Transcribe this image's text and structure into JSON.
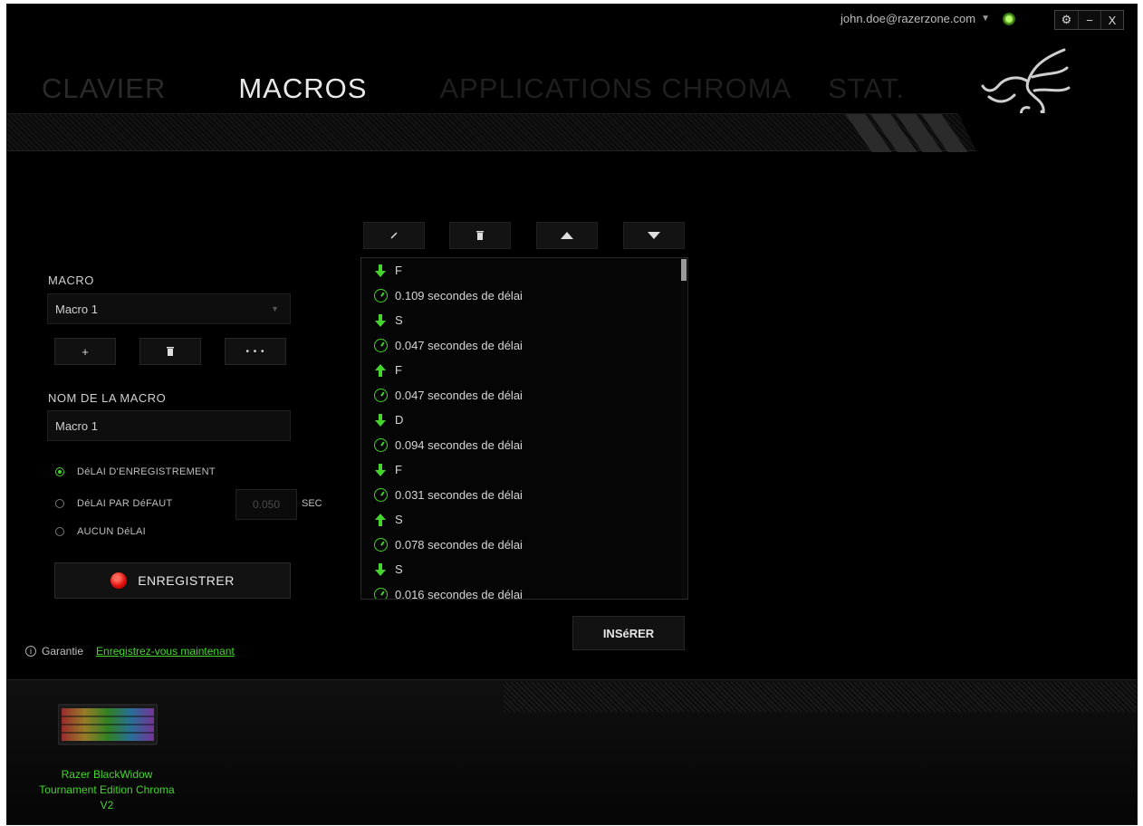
{
  "account": {
    "email": "john.doe@razerzone.com"
  },
  "window_controls": {
    "settings": "⚙",
    "minimize": "−",
    "close": "X"
  },
  "tabs": [
    {
      "label": "CLAVIER",
      "active": false
    },
    {
      "label": "MACROS",
      "active": true
    },
    {
      "label": "APPLICATIONS CHROMA",
      "active": false
    },
    {
      "label": "STAT.",
      "active": false
    }
  ],
  "macro": {
    "section_label": "MACRO",
    "selected": "Macro 1",
    "add_label": "+",
    "delete_icon": "trash-icon",
    "more_label": "• • •",
    "name_label": "NOM DE LA MACRO",
    "name_value": "Macro 1"
  },
  "delay_options": [
    {
      "label": "DéLAI D'ENREGISTREMENT",
      "selected": true
    },
    {
      "label": "DéLAI PAR DéFAUT",
      "selected": false
    },
    {
      "label": "AUCUN DéLAI",
      "selected": false
    }
  ],
  "default_delay": {
    "value": "0.050",
    "unit": "SEC"
  },
  "record_label": "ENREGISTRER",
  "list_toolbar": [
    "edit-icon",
    "trash-icon",
    "move-up-icon",
    "move-down-icon"
  ],
  "events": [
    {
      "kind": "down",
      "text": "F"
    },
    {
      "kind": "delay",
      "text": "0.109 secondes de délai"
    },
    {
      "kind": "down",
      "text": "S"
    },
    {
      "kind": "delay",
      "text": "0.047 secondes de délai"
    },
    {
      "kind": "up",
      "text": "F"
    },
    {
      "kind": "delay",
      "text": "0.047 secondes de délai"
    },
    {
      "kind": "down",
      "text": "D"
    },
    {
      "kind": "delay",
      "text": "0.094 secondes de délai"
    },
    {
      "kind": "down",
      "text": "F"
    },
    {
      "kind": "delay",
      "text": "0.031 secondes de délai"
    },
    {
      "kind": "up",
      "text": "S"
    },
    {
      "kind": "delay",
      "text": "0.078 secondes de délai"
    },
    {
      "kind": "down",
      "text": "S"
    },
    {
      "kind": "delay",
      "text": "0.016 secondes de délai"
    }
  ],
  "insert_label": "INSéRER",
  "warranty": {
    "label": "Garantie",
    "link": "Enregistrez-vous maintenant"
  },
  "device": {
    "name": "Razer BlackWidow Tournament Edition Chroma V2"
  },
  "colors": {
    "accent": "#44d62c",
    "record": "#e01010",
    "background": "#000000"
  }
}
